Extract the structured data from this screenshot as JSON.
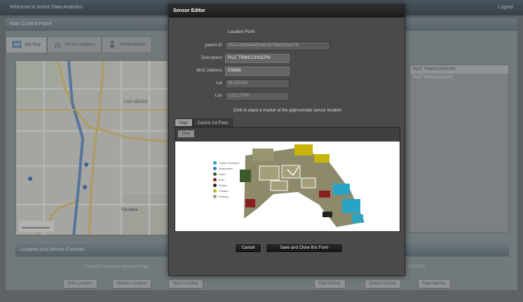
{
  "app": {
    "title": "Welcome to Active Data Analytics",
    "logout": "Logout",
    "panel_title": "Main Control Panel",
    "tabs": [
      {
        "label": "Ally Map",
        "icon": "map-icon"
      },
      {
        "label": "Sensor Analytics",
        "icon": "chart-icon"
      },
      {
        "label": "Administration",
        "icon": "person-icon"
      }
    ],
    "map": {
      "city_label": "LAS VEGAS",
      "town_label": "Paradise"
    },
    "sensors": [
      "PILE TR8NCCHOCPN",
      "PILE TR8NCHOCPN"
    ],
    "controls_title": "Location and Sensor Controls",
    "location_text": "Location Selected: Name of Mapp",
    "sensor_text": "CHOCPN",
    "buttons": [
      "Edit Location",
      "Delete Location",
      "New Location",
      "Edit Sensor",
      "Delete Sensor",
      "New Sensor"
    ]
  },
  "modal": {
    "title": "Sensor Editor",
    "form_title": "Location Form",
    "fields": [
      {
        "label": "parent ID",
        "value": "1f3a7c9b2d4e6f0a8c5b7d9e1f3a5c7b"
      },
      {
        "label": "Description",
        "value": "PILE TR8NCCHOCPN"
      },
      {
        "label": "MAC Address",
        "value": "E5BB8"
      },
      {
        "label": "Lat",
        "value": "36.151004"
      },
      {
        "label": "Lon",
        "value": "-115.17780"
      }
    ],
    "instruction": "Click to place a marker at the approximate sensor location",
    "tabs": [
      "Map",
      "Casino 1st Floor"
    ],
    "floor_button": "Floor",
    "legend": [
      "Casino Entrance",
      "Restaurant",
      "Hotel",
      "Pool",
      "Shops",
      "Theatre",
      "Parking"
    ],
    "cancel": "Cancel",
    "save": "Save and Close this Form"
  }
}
